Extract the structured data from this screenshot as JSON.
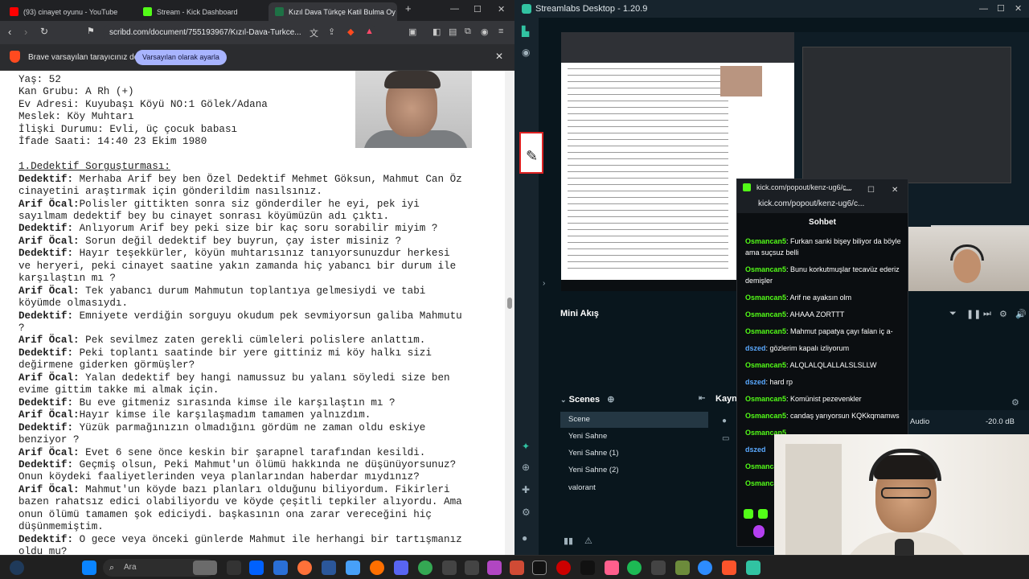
{
  "browser": {
    "tabs": [
      {
        "label": "(93) cinayet oyunu - YouTube",
        "color": "#ff0000"
      },
      {
        "label": "Stream - Kick Dashboard",
        "color": "#53fc18"
      },
      {
        "label": "Kızıl Dava Türkçe Katil Bulma Oy",
        "color": "#1e7145"
      }
    ],
    "new_tab": "+",
    "url": "scribd.com/document/755193967/Kızıl-Dava-Turkce...",
    "infobar": {
      "message": "Brave varsayılan tarayıcınız değil",
      "button": "Varsayılan olarak ayarla",
      "close": "✕"
    }
  },
  "document": {
    "lines": [
      {
        "pre": "",
        "bold": "",
        "text": "Yaş: 52"
      },
      {
        "pre": "",
        "bold": "",
        "text": "Kan Grubu: A Rh (+)"
      },
      {
        "pre": "",
        "bold": "",
        "text": "Ev Adresi: Kuyubaşı Köyü NO:1 Gölek/Adana"
      },
      {
        "pre": "",
        "bold": "",
        "text": "Meslek: Köy Muhtarı"
      },
      {
        "pre": "",
        "bold": "",
        "text": "İlişki Durumu: Evli, üç çocuk babası"
      },
      {
        "pre": "",
        "bold": "",
        "text": "İfade Saati: 14:40 23 Ekim 1980"
      },
      {
        "pre": "",
        "bold": "",
        "text": ""
      },
      {
        "pre": "",
        "bold": "",
        "text": "1.Dedektif Sorguşturması:"
      },
      {
        "pre": "",
        "bold": "Dedektif:",
        "text": " Merhaba Arif bey ben Özel Dedektif Mehmet Göksun, Mahmut Can Öz"
      },
      {
        "pre": "",
        "bold": "",
        "text": "cinayetini araştırmak için gönderildim nasılsınız."
      },
      {
        "pre": "",
        "bold": "Arif Öcal:",
        "text": "Polisler gittikten sonra siz gönderdiler he eyi, pek iyi"
      },
      {
        "pre": "",
        "bold": "",
        "text": "sayılmam dedektif bey bu cinayet sonrası köyümüzün adı çıktı."
      },
      {
        "pre": "",
        "bold": "Dedektif:",
        "text": " Anlıyorum Arif bey peki size bir kaç soru sorabilir miyim ?"
      },
      {
        "pre": "",
        "bold": "Arif Öcal:",
        "text": " Sorun değil dedektif bey buyrun, çay ister misiniz ?"
      },
      {
        "pre": "",
        "bold": "Dedektif:",
        "text": " Hayır teşekkürler, köyün muhtarısınız tanıyorsunuzdur herkesi"
      },
      {
        "pre": "",
        "bold": "",
        "text": "ve heryeri, peki cinayet saatine yakın zamanda hiç yabancı bir durum ile"
      },
      {
        "pre": "",
        "bold": "",
        "text": "karşılaştın mı ?"
      },
      {
        "pre": "",
        "bold": "Arif Öcal:",
        "text": " Tek yabancı durum Mahmutun toplantıya gelmesiydi ve tabi"
      },
      {
        "pre": "",
        "bold": "",
        "text": "köyümde olmasıydı."
      },
      {
        "pre": "",
        "bold": "Dedektif:",
        "text": " Emniyete verdiğin sorguyu okudum pek sevmiyorsun galiba Mahmutu"
      },
      {
        "pre": "",
        "bold": "",
        "text": "?"
      },
      {
        "pre": "",
        "bold": "Arif Öcal:",
        "text": " Pek sevilmez zaten gerekli cümleleri polislere anlattım."
      },
      {
        "pre": "",
        "bold": "Dedektif:",
        "text": " Peki toplantı saatinde bir yere gittiniz mi köy halkı sizi"
      },
      {
        "pre": "",
        "bold": "",
        "text": "değirmene giderken görmüşler?"
      },
      {
        "pre": "",
        "bold": "Arif Öcal:",
        "text": " Yalan dedektif bey hangi namussuz bu yalanı söyledi size ben"
      },
      {
        "pre": "",
        "bold": "",
        "text": "evime gittim takke mi almak için."
      },
      {
        "pre": "",
        "bold": "Dedektif:",
        "text": " Bu eve gitmeniz sırasında kimse ile karşılaştın mı ?"
      },
      {
        "pre": "",
        "bold": "Arif Öcal:",
        "text": "Hayır kimse ile karşılaşmadım tamamen yalnızdım."
      },
      {
        "pre": "",
        "bold": "Dedektif:",
        "text": " Yüzük parmağınızın olmadığını gördüm ne zaman oldu eskiye"
      },
      {
        "pre": "",
        "bold": "",
        "text": "benziyor ?"
      },
      {
        "pre": "",
        "bold": "Arif Öcal:",
        "text": " Evet 6 sene önce keskin bir şarapnel tarafından kesildi."
      },
      {
        "pre": "",
        "bold": "Dedektif:",
        "text": " Geçmiş olsun, Peki Mahmut'un ölümü hakkında ne düşünüyorsunuz?"
      },
      {
        "pre": "",
        "bold": "",
        "text": "Onun köydeki faaliyetlerinden veya planlarından haberdar mıydınız?"
      },
      {
        "pre": "",
        "bold": "Arif Öcal:",
        "text": " Mahmut'un köyde bazı planları olduğunu biliyordum. Fikirleri"
      },
      {
        "pre": "",
        "bold": "",
        "text": "bazen rahatsız edici olabiliyordu ve köyde çeşitli tepkiler alıyordu. Ama"
      },
      {
        "pre": "",
        "bold": "",
        "text": "onun ölümü tamamen şok ediciydi. başkasının ona zarar vereceğini hiç"
      },
      {
        "pre": "",
        "bold": "",
        "text": "düşünmemiştim."
      },
      {
        "pre": "",
        "bold": "Dedektif:",
        "text": " O gece veya önceki günlerde Mahmut ile herhangi bir tartışmanız"
      },
      {
        "pre": "",
        "bold": "",
        "text": "oldu mu?"
      }
    ]
  },
  "taskbar": {
    "search_placeholder": "Ara"
  },
  "streamlabs": {
    "title": "Streamlabs Desktop - 1.20.9",
    "mini_flow": "Mini Akış",
    "scenes_header": "Scenes",
    "sources_header": "Kayn",
    "scenes": [
      "Scene",
      "Yeni Sahne",
      "Yeni Sahne (1)",
      "Yeni Sahne (2)",
      "valorant"
    ],
    "audio": {
      "name": "Audio",
      "db": "-20.0 dB"
    }
  },
  "chat": {
    "window_title": "kick.com/popout/kenz-ug6/c...",
    "url": "kick.com/popout/kenz-ug6/c...",
    "heading": "Sohbet",
    "messages": [
      {
        "user": "Osmancan5",
        "text": "Furkan sanki bişey biliyor da böyle ama suçsuz belli"
      },
      {
        "user": "Osmancan5",
        "text": "Bunu korkutmuşlar tecavüz ederiz demişler"
      },
      {
        "user": "Osmancan5",
        "text": "Arif ne ayaksın olm"
      },
      {
        "user": "Osmancan5",
        "text": "AHAAA ZORTTT"
      },
      {
        "user": "Osmancan5",
        "text": "Mahmut papatya çayı falan iç a-"
      },
      {
        "user": "dszed",
        "text": "gözlerim kapalı izliyorum"
      },
      {
        "user": "Osmancan5",
        "text": "ALQLALQLALLALSLSLLW"
      },
      {
        "user": "dszed",
        "text": "hard rp"
      },
      {
        "user": "Osmancan5",
        "text": "Komünist pezevenkler"
      },
      {
        "user": "Osmancan5",
        "text": "candaş yarıyorsun KQKkqmamws"
      },
      {
        "user": "Osmancan5",
        "text": ""
      },
      {
        "user": "dszed",
        "text": ""
      },
      {
        "user": "Osmancan5",
        "text": ""
      },
      {
        "user": "Osmancan5",
        "text": ""
      }
    ]
  }
}
